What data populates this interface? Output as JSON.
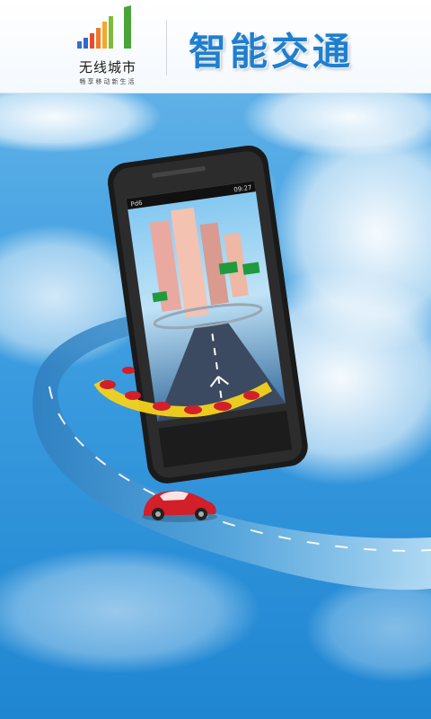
{
  "brand": {
    "name": "无线城市",
    "tagline": "畅享移动新生活"
  },
  "app": {
    "title": "智能交通"
  },
  "phone": {
    "status_label": "Pd6",
    "status_time": "09:27"
  },
  "colors": {
    "sky": "#2a8fd6",
    "title_blue": "#1e7fd0",
    "road": "#3e8ac4",
    "lane_yellow": "#f4d21c",
    "car_red": "#d21f2a"
  }
}
